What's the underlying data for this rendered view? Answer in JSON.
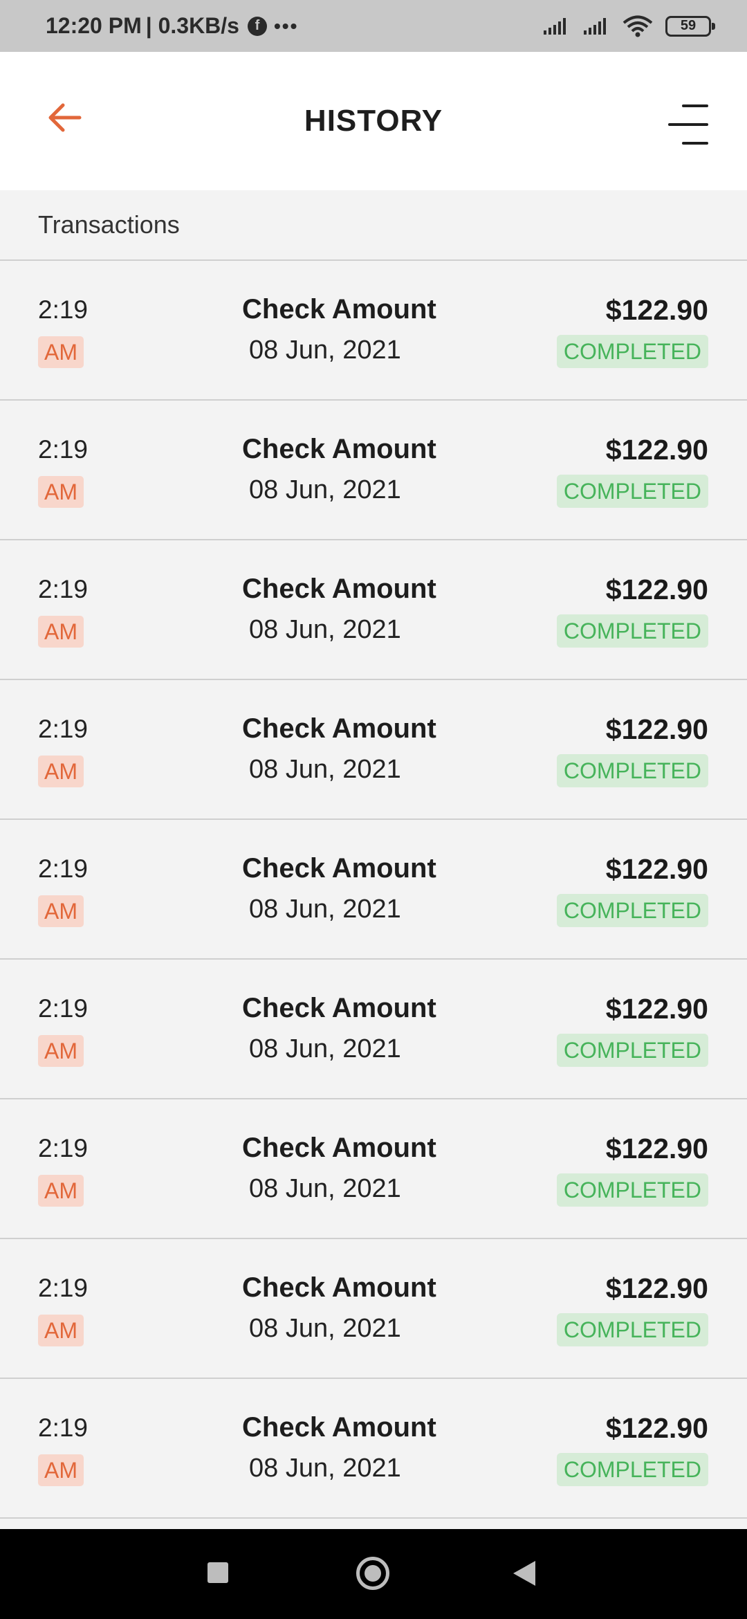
{
  "status_bar": {
    "time": "12:20 PM",
    "speed": "| 0.3KB/s",
    "app_icon_letter": "f",
    "more": "•••",
    "battery": "59"
  },
  "header": {
    "title": "HISTORY",
    "back_icon": "arrow-left-icon",
    "menu_icon": "menu-lines-icon",
    "accent_color": "#e2673a"
  },
  "section": {
    "label": "Transactions"
  },
  "transactions": [
    {
      "time": "2:19",
      "ampm": "AM",
      "title": "Check Amount",
      "date": "08 Jun, 2021",
      "amount": "$122.90",
      "status": "COMPLETED"
    },
    {
      "time": "2:19",
      "ampm": "AM",
      "title": "Check Amount",
      "date": "08 Jun, 2021",
      "amount": "$122.90",
      "status": "COMPLETED"
    },
    {
      "time": "2:19",
      "ampm": "AM",
      "title": "Check Amount",
      "date": "08 Jun, 2021",
      "amount": "$122.90",
      "status": "COMPLETED"
    },
    {
      "time": "2:19",
      "ampm": "AM",
      "title": "Check Amount",
      "date": "08 Jun, 2021",
      "amount": "$122.90",
      "status": "COMPLETED"
    },
    {
      "time": "2:19",
      "ampm": "AM",
      "title": "Check Amount",
      "date": "08 Jun, 2021",
      "amount": "$122.90",
      "status": "COMPLETED"
    },
    {
      "time": "2:19",
      "ampm": "AM",
      "title": "Check Amount",
      "date": "08 Jun, 2021",
      "amount": "$122.90",
      "status": "COMPLETED"
    },
    {
      "time": "2:19",
      "ampm": "AM",
      "title": "Check Amount",
      "date": "08 Jun, 2021",
      "amount": "$122.90",
      "status": "COMPLETED"
    },
    {
      "time": "2:19",
      "ampm": "AM",
      "title": "Check Amount",
      "date": "08 Jun, 2021",
      "amount": "$122.90",
      "status": "COMPLETED"
    },
    {
      "time": "2:19",
      "ampm": "AM",
      "title": "Check Amount",
      "date": "08 Jun, 2021",
      "amount": "$122.90",
      "status": "COMPLETED"
    }
  ],
  "colors": {
    "ampm_bg": "#f8d6cb",
    "ampm_text": "#e2673a",
    "status_bg": "#d6ecd7",
    "status_text": "#46b35a"
  },
  "nav_bar": {
    "recents_icon": "square-recents-icon",
    "home_icon": "circle-home-icon",
    "back_icon": "triangle-back-icon"
  }
}
